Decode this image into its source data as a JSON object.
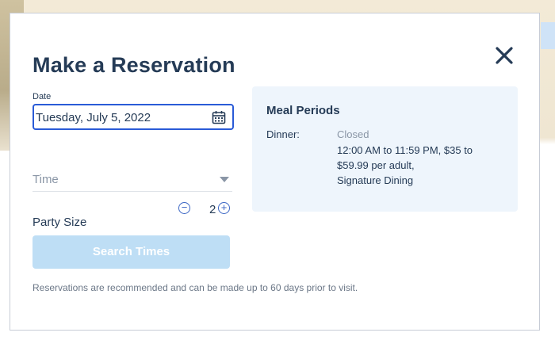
{
  "modal": {
    "title": "Make a Reservation",
    "close_icon": "close-icon"
  },
  "form": {
    "date_label": "Date",
    "date_value": "Tuesday, July 5, 2022",
    "time_placeholder": "Time",
    "party_size_label": "Party Size",
    "party_size_value": "2",
    "search_button": "Search Times",
    "footnote": "Reservations are recommended and can be made up to 60 days prior to visit."
  },
  "meal_periods": {
    "title": "Meal Periods",
    "items": [
      {
        "name": "Dinner:",
        "status": "Closed",
        "details": [
          "12:00 AM to 11:59 PM, $35 to",
          "$59.99 per adult,",
          "Signature Dining"
        ]
      }
    ]
  },
  "colors": {
    "primary_text": "#253b56",
    "accent": "#2a5bd7",
    "button_disabled": "#bedef5",
    "panel_bg": "#eef5fc"
  }
}
